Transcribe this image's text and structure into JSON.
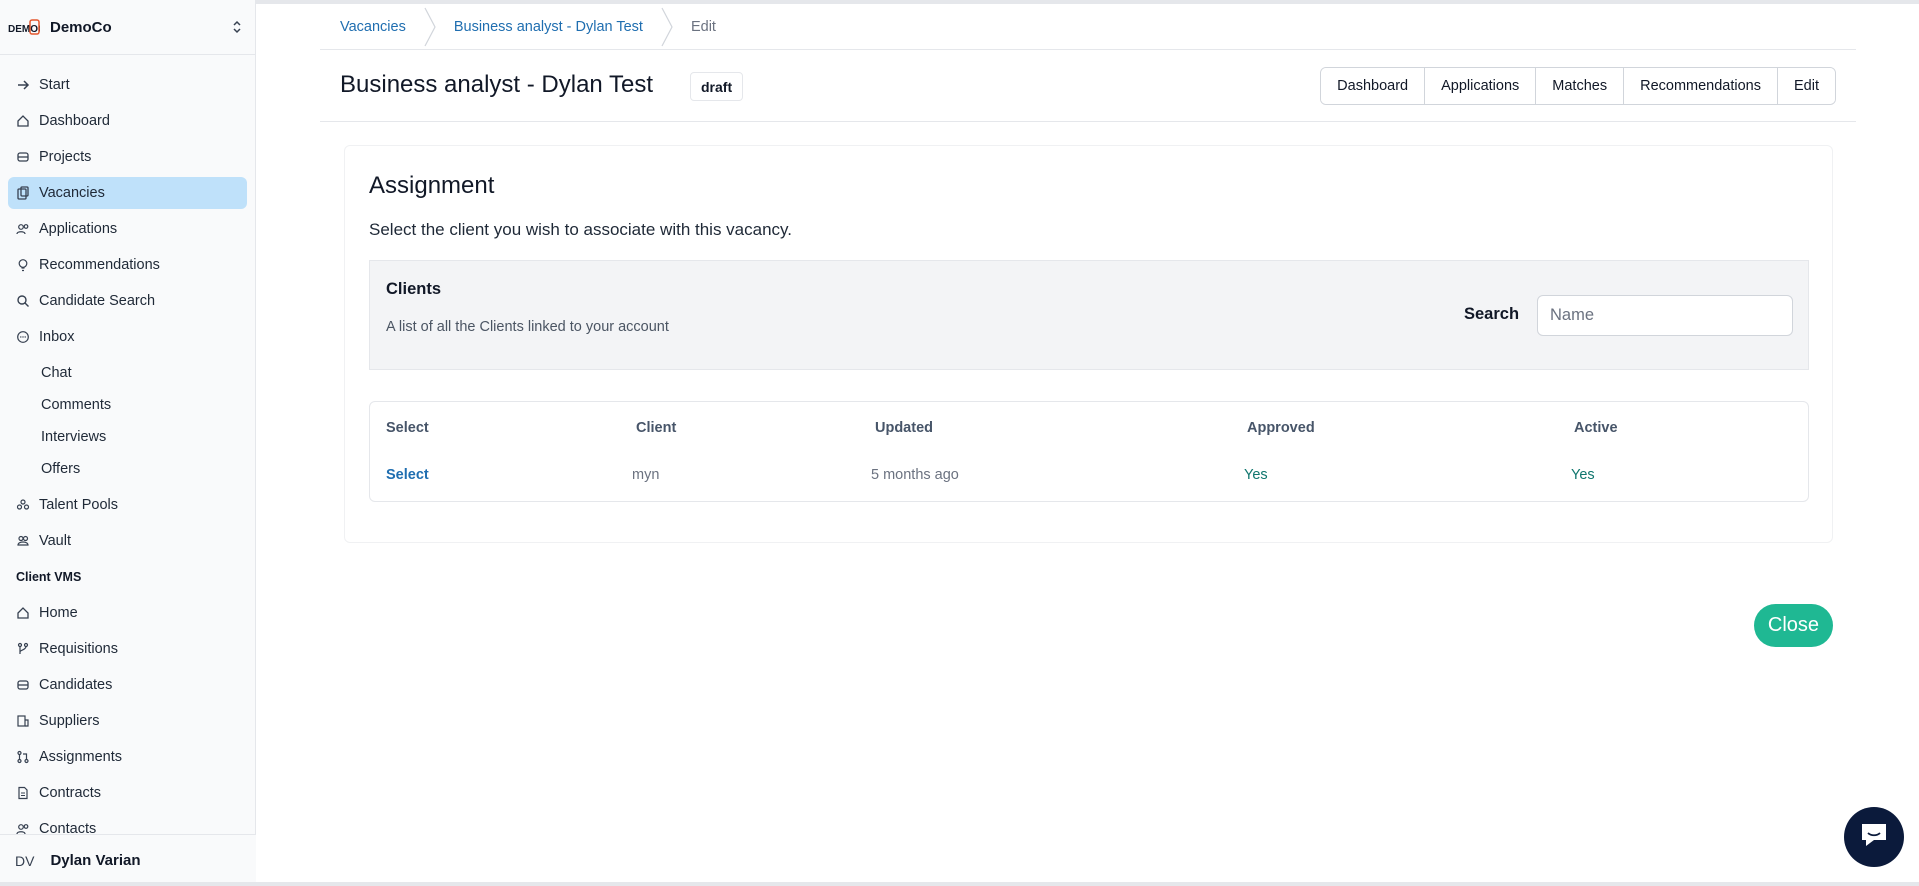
{
  "org": {
    "name": "DemoCo",
    "logo_text": "DEMOCO"
  },
  "sidebar": {
    "items": [
      {
        "label": "Start",
        "icon": "arrow-right-icon"
      },
      {
        "label": "Dashboard",
        "icon": "home-icon"
      },
      {
        "label": "Projects",
        "icon": "stack-icon"
      },
      {
        "label": "Vacancies",
        "icon": "clipboard-icon",
        "active": true
      },
      {
        "label": "Applications",
        "icon": "users-icon"
      },
      {
        "label": "Recommendations",
        "icon": "lightbulb-icon"
      },
      {
        "label": "Candidate Search",
        "icon": "search-icon"
      },
      {
        "label": "Inbox",
        "icon": "chat-icon"
      }
    ],
    "inbox_sub": [
      "Chat",
      "Comments",
      "Interviews",
      "Offers"
    ],
    "items2": [
      {
        "label": "Talent Pools",
        "icon": "pools-icon"
      },
      {
        "label": "Vault",
        "icon": "vault-icon"
      }
    ],
    "section_label": "Client VMS",
    "vms_items": [
      {
        "label": "Home",
        "icon": "home-icon"
      },
      {
        "label": "Requisitions",
        "icon": "branch-icon"
      },
      {
        "label": "Candidates",
        "icon": "stack-icon"
      },
      {
        "label": "Suppliers",
        "icon": "building-icon"
      },
      {
        "label": "Assignments",
        "icon": "pull-request-icon"
      },
      {
        "label": "Contracts",
        "icon": "document-icon"
      },
      {
        "label": "Contacts",
        "icon": "users-icon"
      }
    ],
    "user": {
      "initials": "DV",
      "name": "Dylan Varian"
    }
  },
  "breadcrumb": {
    "items": [
      "Vacancies",
      "Business analyst - Dylan Test"
    ],
    "current": "Edit"
  },
  "header": {
    "title": "Business analyst - Dylan Test",
    "status": "draft",
    "tabs": [
      "Dashboard",
      "Applications",
      "Matches",
      "Recommendations",
      "Edit"
    ]
  },
  "assignment": {
    "title": "Assignment",
    "description": "Select the client you wish to associate with this vacancy.",
    "panel": {
      "title": "Clients",
      "description": "A list of all the Clients linked to your account",
      "search_label": "Search",
      "search_placeholder": "Name",
      "search_value": ""
    },
    "table": {
      "columns": [
        "Select",
        "Client",
        "Updated",
        "Approved",
        "Active"
      ],
      "rows": [
        {
          "select": "Select",
          "client": "myn",
          "updated": "5 months ago",
          "approved": "Yes",
          "active": "Yes"
        }
      ]
    }
  },
  "close_label": "Close",
  "colors": {
    "accent": "#1f6eb0",
    "active_nav": "#bfe1fa",
    "close_button": "#1fb893",
    "status_green": "#0f766e",
    "chat_bubble": "#0b1a3b"
  }
}
